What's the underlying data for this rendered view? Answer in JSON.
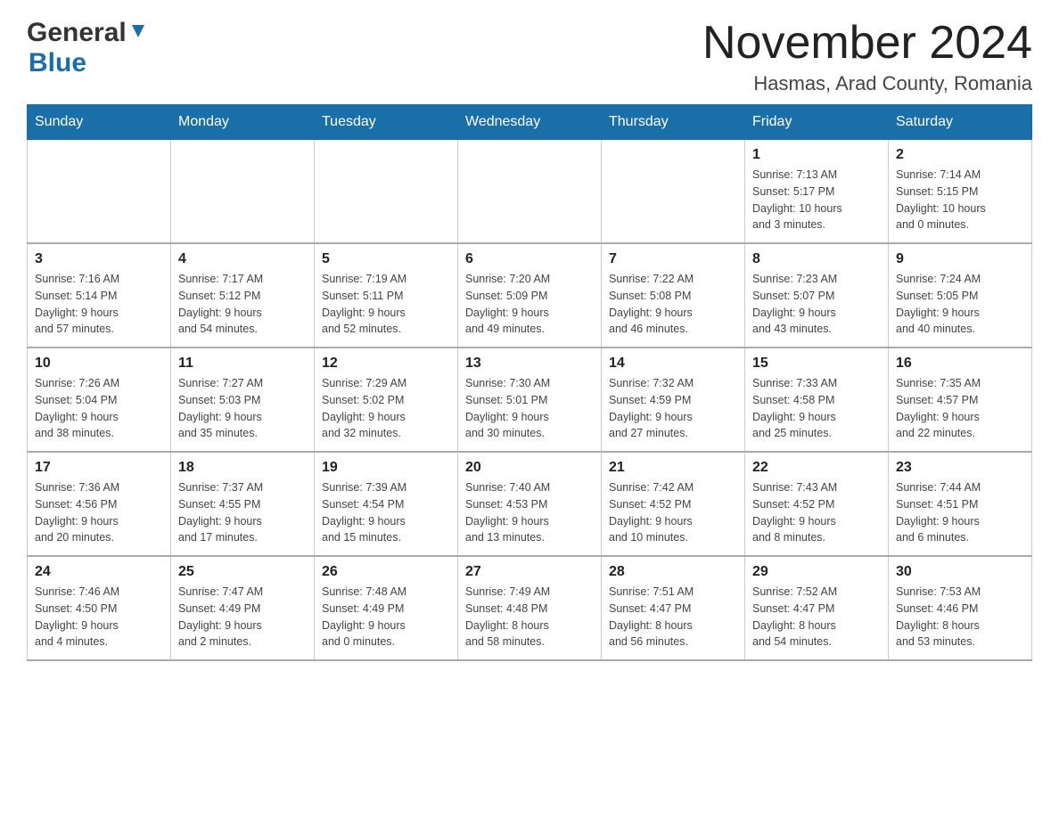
{
  "logo": {
    "general": "General",
    "blue": "Blue"
  },
  "header": {
    "title": "November 2024",
    "subtitle": "Hasmas, Arad County, Romania"
  },
  "weekdays": [
    "Sunday",
    "Monday",
    "Tuesday",
    "Wednesday",
    "Thursday",
    "Friday",
    "Saturday"
  ],
  "weeks": [
    [
      {
        "day": "",
        "info": ""
      },
      {
        "day": "",
        "info": ""
      },
      {
        "day": "",
        "info": ""
      },
      {
        "day": "",
        "info": ""
      },
      {
        "day": "",
        "info": ""
      },
      {
        "day": "1",
        "info": "Sunrise: 7:13 AM\nSunset: 5:17 PM\nDaylight: 10 hours\nand 3 minutes."
      },
      {
        "day": "2",
        "info": "Sunrise: 7:14 AM\nSunset: 5:15 PM\nDaylight: 10 hours\nand 0 minutes."
      }
    ],
    [
      {
        "day": "3",
        "info": "Sunrise: 7:16 AM\nSunset: 5:14 PM\nDaylight: 9 hours\nand 57 minutes."
      },
      {
        "day": "4",
        "info": "Sunrise: 7:17 AM\nSunset: 5:12 PM\nDaylight: 9 hours\nand 54 minutes."
      },
      {
        "day": "5",
        "info": "Sunrise: 7:19 AM\nSunset: 5:11 PM\nDaylight: 9 hours\nand 52 minutes."
      },
      {
        "day": "6",
        "info": "Sunrise: 7:20 AM\nSunset: 5:09 PM\nDaylight: 9 hours\nand 49 minutes."
      },
      {
        "day": "7",
        "info": "Sunrise: 7:22 AM\nSunset: 5:08 PM\nDaylight: 9 hours\nand 46 minutes."
      },
      {
        "day": "8",
        "info": "Sunrise: 7:23 AM\nSunset: 5:07 PM\nDaylight: 9 hours\nand 43 minutes."
      },
      {
        "day": "9",
        "info": "Sunrise: 7:24 AM\nSunset: 5:05 PM\nDaylight: 9 hours\nand 40 minutes."
      }
    ],
    [
      {
        "day": "10",
        "info": "Sunrise: 7:26 AM\nSunset: 5:04 PM\nDaylight: 9 hours\nand 38 minutes."
      },
      {
        "day": "11",
        "info": "Sunrise: 7:27 AM\nSunset: 5:03 PM\nDaylight: 9 hours\nand 35 minutes."
      },
      {
        "day": "12",
        "info": "Sunrise: 7:29 AM\nSunset: 5:02 PM\nDaylight: 9 hours\nand 32 minutes."
      },
      {
        "day": "13",
        "info": "Sunrise: 7:30 AM\nSunset: 5:01 PM\nDaylight: 9 hours\nand 30 minutes."
      },
      {
        "day": "14",
        "info": "Sunrise: 7:32 AM\nSunset: 4:59 PM\nDaylight: 9 hours\nand 27 minutes."
      },
      {
        "day": "15",
        "info": "Sunrise: 7:33 AM\nSunset: 4:58 PM\nDaylight: 9 hours\nand 25 minutes."
      },
      {
        "day": "16",
        "info": "Sunrise: 7:35 AM\nSunset: 4:57 PM\nDaylight: 9 hours\nand 22 minutes."
      }
    ],
    [
      {
        "day": "17",
        "info": "Sunrise: 7:36 AM\nSunset: 4:56 PM\nDaylight: 9 hours\nand 20 minutes."
      },
      {
        "day": "18",
        "info": "Sunrise: 7:37 AM\nSunset: 4:55 PM\nDaylight: 9 hours\nand 17 minutes."
      },
      {
        "day": "19",
        "info": "Sunrise: 7:39 AM\nSunset: 4:54 PM\nDaylight: 9 hours\nand 15 minutes."
      },
      {
        "day": "20",
        "info": "Sunrise: 7:40 AM\nSunset: 4:53 PM\nDaylight: 9 hours\nand 13 minutes."
      },
      {
        "day": "21",
        "info": "Sunrise: 7:42 AM\nSunset: 4:52 PM\nDaylight: 9 hours\nand 10 minutes."
      },
      {
        "day": "22",
        "info": "Sunrise: 7:43 AM\nSunset: 4:52 PM\nDaylight: 9 hours\nand 8 minutes."
      },
      {
        "day": "23",
        "info": "Sunrise: 7:44 AM\nSunset: 4:51 PM\nDaylight: 9 hours\nand 6 minutes."
      }
    ],
    [
      {
        "day": "24",
        "info": "Sunrise: 7:46 AM\nSunset: 4:50 PM\nDaylight: 9 hours\nand 4 minutes."
      },
      {
        "day": "25",
        "info": "Sunrise: 7:47 AM\nSunset: 4:49 PM\nDaylight: 9 hours\nand 2 minutes."
      },
      {
        "day": "26",
        "info": "Sunrise: 7:48 AM\nSunset: 4:49 PM\nDaylight: 9 hours\nand 0 minutes."
      },
      {
        "day": "27",
        "info": "Sunrise: 7:49 AM\nSunset: 4:48 PM\nDaylight: 8 hours\nand 58 minutes."
      },
      {
        "day": "28",
        "info": "Sunrise: 7:51 AM\nSunset: 4:47 PM\nDaylight: 8 hours\nand 56 minutes."
      },
      {
        "day": "29",
        "info": "Sunrise: 7:52 AM\nSunset: 4:47 PM\nDaylight: 8 hours\nand 54 minutes."
      },
      {
        "day": "30",
        "info": "Sunrise: 7:53 AM\nSunset: 4:46 PM\nDaylight: 8 hours\nand 53 minutes."
      }
    ]
  ]
}
